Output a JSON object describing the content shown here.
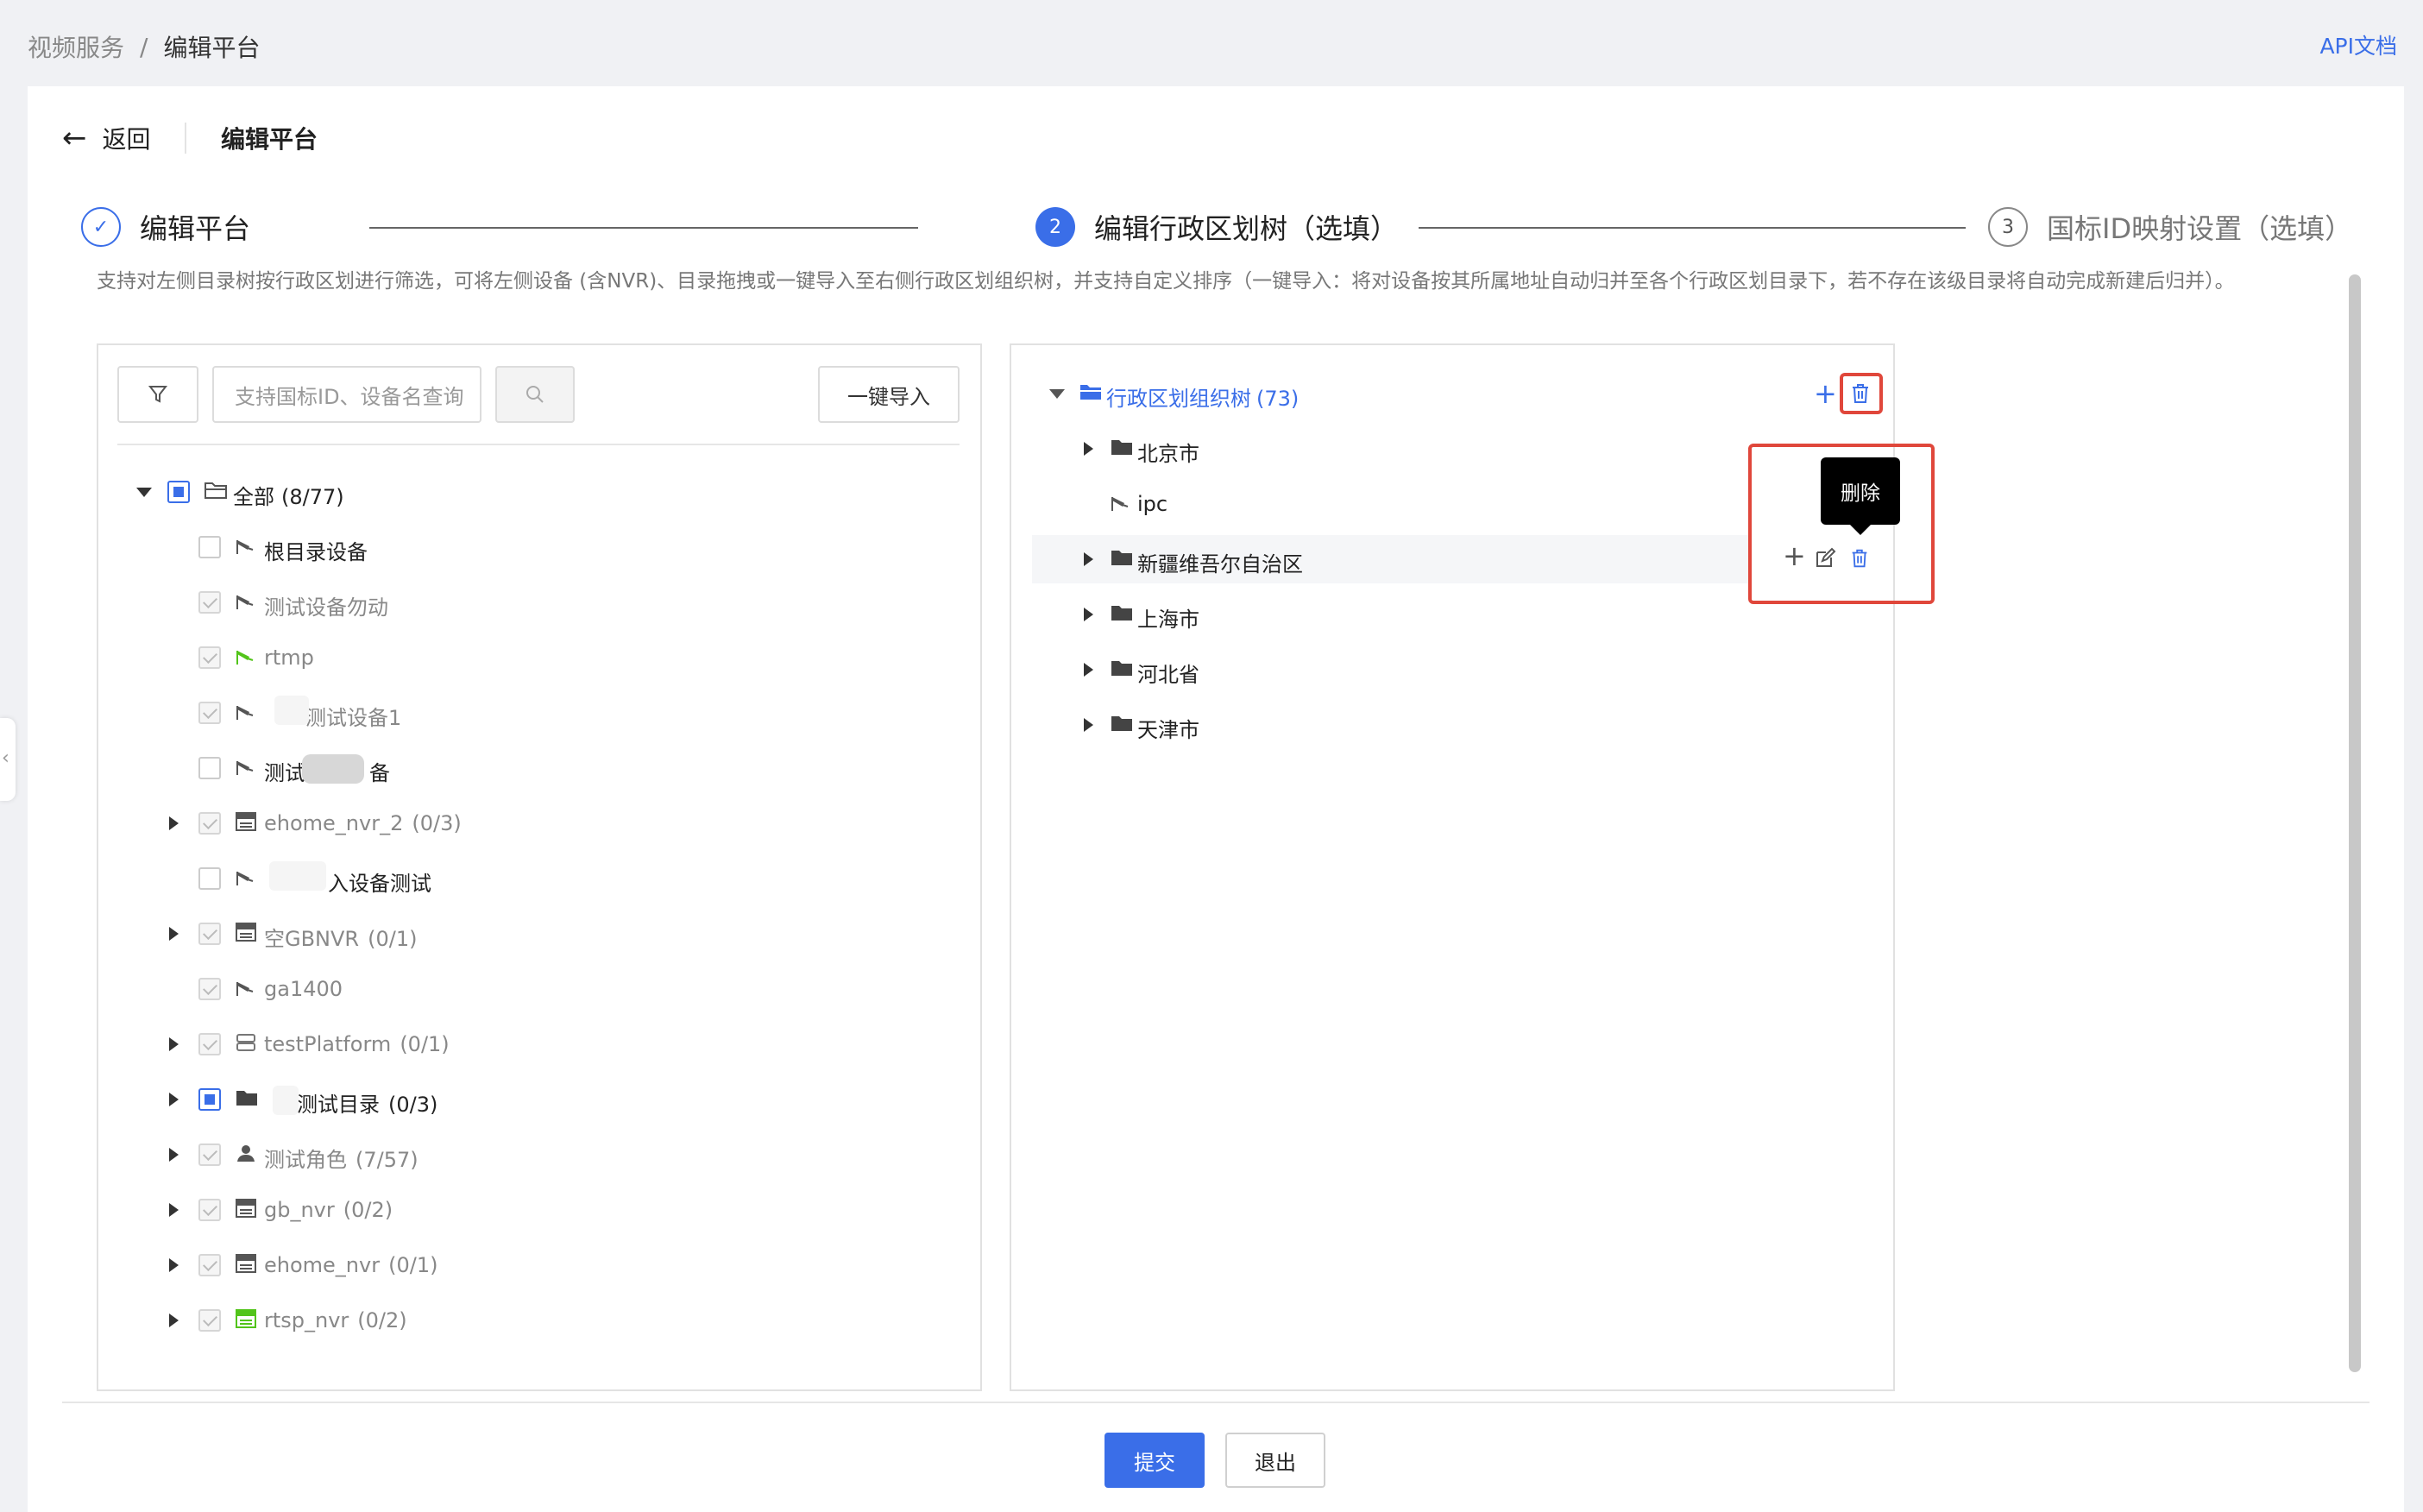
{
  "breadcrumb": {
    "parent": "视频服务",
    "separator": "/",
    "current": "编辑平台"
  },
  "header": {
    "api_link": "API文档",
    "back_label": "返回",
    "page_title": "编辑平台"
  },
  "steps": [
    {
      "number": "✓",
      "label": "编辑平台",
      "state": "done"
    },
    {
      "number": "2",
      "label": "编辑行政区划树（选填）",
      "state": "active"
    },
    {
      "number": "3",
      "label": "国标ID映射设置（选填）",
      "state": "todo"
    }
  ],
  "description": "支持对左侧目录树按行政区划进行筛选，可将左侧设备 (含NVR)、目录拖拽或一键导入至右侧行政区划组织树，并支持自定义排序（一键导入：将对设备按其所属地址自动归并至各个行政区划目录下，若不存在该级目录将自动完成新建后归并）。",
  "left_panel": {
    "search_placeholder": "支持国标ID、设备名查询",
    "import_button": "一键导入",
    "root": {
      "label": "全部",
      "count": "(8/77)"
    },
    "items": [
      {
        "label": "根目录设备",
        "count": "",
        "icon": "camera-icon"
      },
      {
        "label": "测试设备勿动",
        "count": "",
        "icon": "camera-icon"
      },
      {
        "label": "rtmp",
        "count": "",
        "icon": "camera-icon"
      },
      {
        "label": "测试设备1",
        "count": "",
        "icon": "camera-icon"
      },
      {
        "label": "测试",
        "label_tail": "备",
        "count": "",
        "icon": "camera-icon"
      },
      {
        "label": "ehome_nvr_2",
        "count": "(0/3)",
        "icon": "nvr-icon"
      },
      {
        "label": "入设备测试",
        "count": "",
        "icon": "camera-icon"
      },
      {
        "label": "空GBNVR",
        "count": "(0/1)",
        "icon": "nvr-icon"
      },
      {
        "label": "ga1400",
        "count": "",
        "icon": "camera-icon"
      },
      {
        "label": "testPlatform",
        "count": "(0/1)",
        "icon": "server-icon"
      },
      {
        "label": "测试目录",
        "count": "(0/3)",
        "icon": "folder-icon"
      },
      {
        "label": "测试角色",
        "count": "(7/57)",
        "icon": "user-icon"
      },
      {
        "label": "gb_nvr",
        "count": "(0/2)",
        "icon": "nvr-icon"
      },
      {
        "label": "ehome_nvr",
        "count": "(0/1)",
        "icon": "nvr-icon"
      },
      {
        "label": "rtsp_nvr",
        "count": "(0/2)",
        "icon": "nvr-icon"
      }
    ]
  },
  "right_panel": {
    "root": {
      "label": "行政区划组织树",
      "count": "(73)"
    },
    "items": [
      {
        "label": "北京市",
        "icon": "folder-icon"
      },
      {
        "label": "ipc",
        "icon": "camera-icon"
      },
      {
        "label": "新疆维吾尔自治区",
        "icon": "folder-icon"
      },
      {
        "label": "上海市",
        "icon": "folder-icon"
      },
      {
        "label": "河北省",
        "icon": "folder-icon"
      },
      {
        "label": "天津市",
        "icon": "folder-icon"
      }
    ],
    "tooltip": "删除"
  },
  "footer": {
    "submit": "提交",
    "exit": "退出"
  },
  "colors": {
    "accent": "#3a6ee8",
    "highlight": "#e0473b",
    "nvr_green": "#52c41a"
  }
}
